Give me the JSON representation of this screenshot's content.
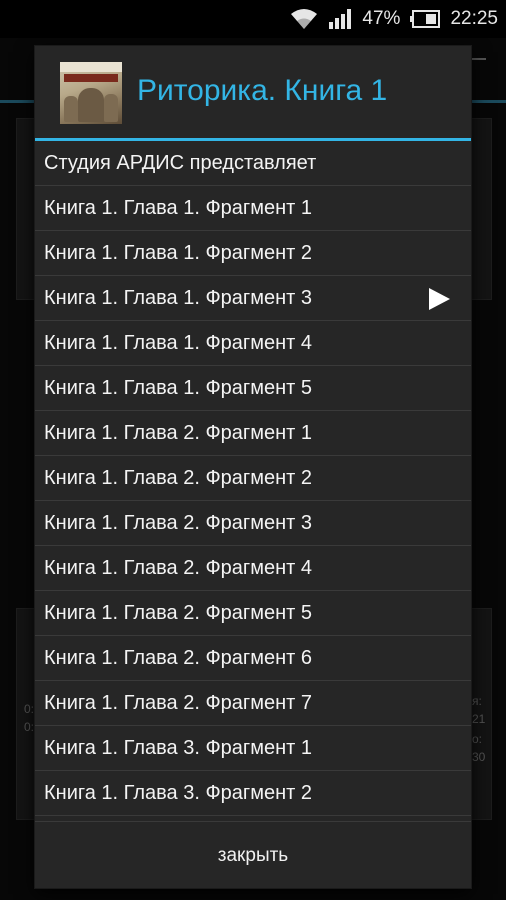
{
  "status_bar": {
    "battery_percent": "47%",
    "time": "22:25",
    "icons": [
      "wifi-icon",
      "signal-icon",
      "battery-icon"
    ]
  },
  "background": {
    "left_labels": [
      "0:",
      "0:"
    ],
    "right_labels": [
      "я:",
      "21",
      "о:",
      "30"
    ]
  },
  "dialog": {
    "title": "Риторика. Книга 1",
    "accent_color": "#33b5e5",
    "items": [
      {
        "label": "Студия АРДИС представляет",
        "playing": false
      },
      {
        "label": "Книга 1. Глава 1. Фрагмент 1",
        "playing": false
      },
      {
        "label": "Книга 1. Глава 1. Фрагмент 2",
        "playing": false
      },
      {
        "label": "Книга 1. Глава 1. Фрагмент 3",
        "playing": true
      },
      {
        "label": "Книга 1. Глава 1. Фрагмент 4",
        "playing": false
      },
      {
        "label": "Книга 1. Глава 1. Фрагмент 5",
        "playing": false
      },
      {
        "label": "Книга 1. Глава 2. Фрагмент 1",
        "playing": false
      },
      {
        "label": "Книга 1. Глава 2. Фрагмент 2",
        "playing": false
      },
      {
        "label": "Книга 1. Глава 2. Фрагмент 3",
        "playing": false
      },
      {
        "label": "Книга 1. Глава 2. Фрагмент 4",
        "playing": false
      },
      {
        "label": "Книга 1. Глава 2. Фрагмент 5",
        "playing": false
      },
      {
        "label": "Книга 1. Глава 2. Фрагмент 6",
        "playing": false
      },
      {
        "label": "Книга 1. Глава 2. Фрагмент 7",
        "playing": false
      },
      {
        "label": "Книга 1. Глава 3. Фрагмент 1",
        "playing": false
      },
      {
        "label": "Книга 1. Глава 3. Фрагмент 2",
        "playing": false
      }
    ],
    "close_label": "закрыть"
  }
}
